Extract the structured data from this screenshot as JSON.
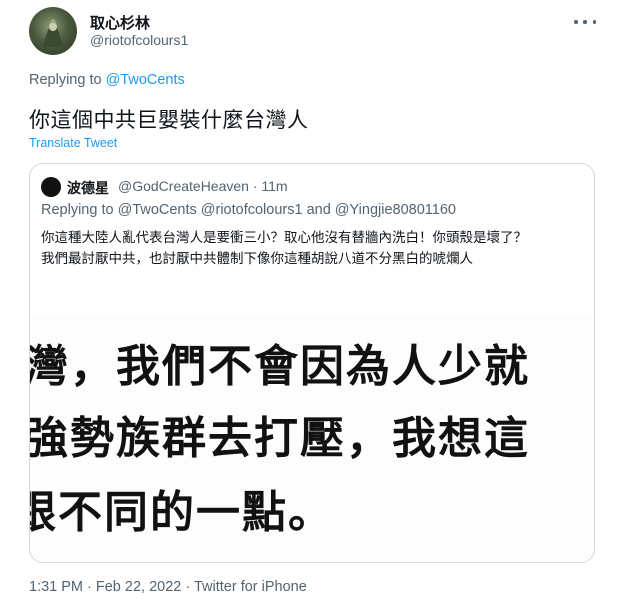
{
  "tweet": {
    "display_name": "取心杉林",
    "handle": "@riotofcolours1",
    "replying_prefix": "Replying to",
    "replying_mention": "@TwoCents",
    "text": "你這個中共巨嬰裝什麼台灣人",
    "translate_label": "Translate Tweet",
    "meta": "1:31 PM · Feb 22, 2022 · Twitter for iPhone",
    "more_icon": "more-icon",
    "colors": {
      "link": "#1d9bf0",
      "secondary": "#536471",
      "border": "#cfd9de"
    }
  },
  "quote": {
    "display_name": "波德星",
    "handle_time": "@GodCreateHeaven · 11m",
    "replying": "Replying to @TwoCents @riotofcolours1 and @Yingjie80801160",
    "text_line1": "你這種大陸人亂代表台灣人是要衝三小？取心他沒有替牆內洗白！你頭殼是壞了？",
    "text_line2": "我們最討厭中共，也討厭中共體制下像你這種胡說八道不分黑白的唬爛人",
    "image_lines": [
      "灣，我們不會因為人少就",
      "強勢族群去打壓，我想這",
      "跟不同的一點。"
    ]
  }
}
